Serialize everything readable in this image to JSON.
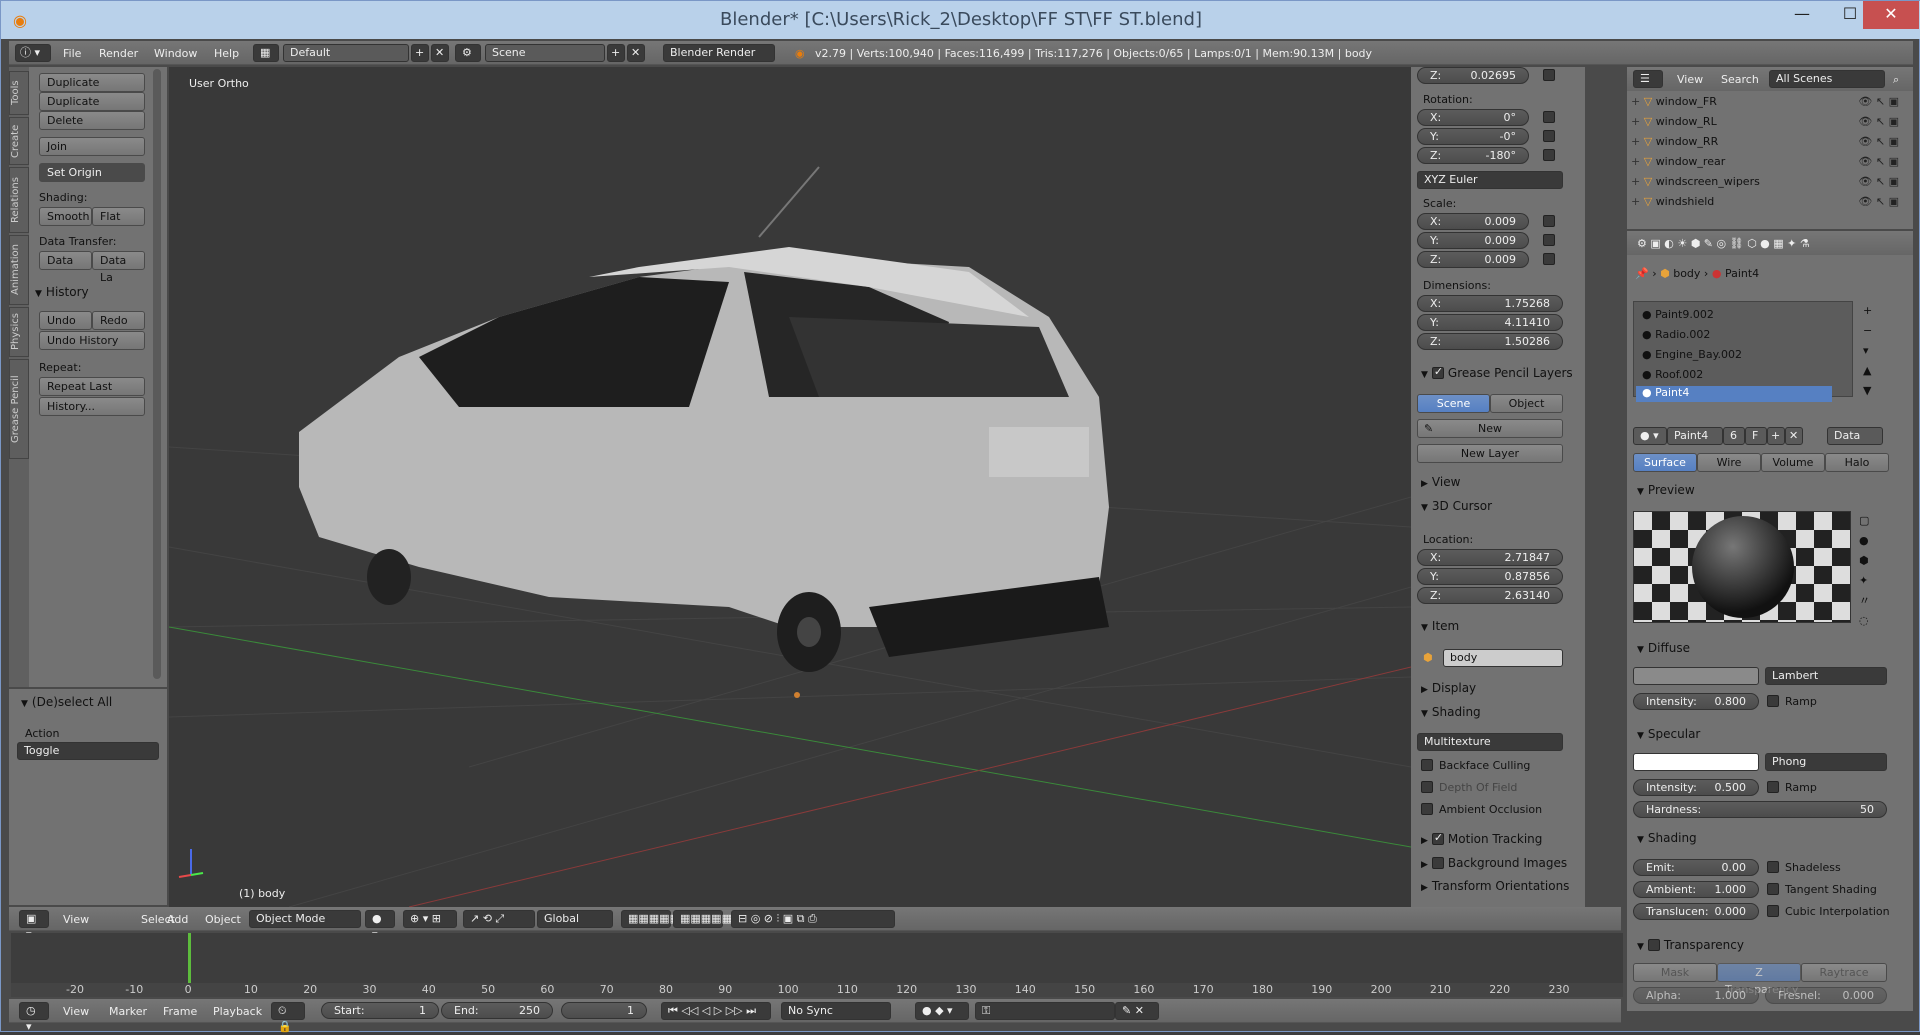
{
  "window": {
    "title": "Blender* [C:\\Users\\Rick_2\\Desktop\\FF ST\\FF ST.blend]",
    "min": "—",
    "max": "☐",
    "close": "✕"
  },
  "topbar": {
    "menus": [
      "File",
      "Render",
      "Window",
      "Help"
    ],
    "screen": "Default",
    "scene": "Scene",
    "engine": "Blender Render",
    "stats": "v2.79 | Verts:100,940 | Faces:116,499 | Tris:117,276 | Objects:0/65 | Lamps:0/1 | Mem:90.13M | body"
  },
  "tools": {
    "tabs": [
      "Tools",
      "Create",
      "Relations",
      "Animation",
      "Physics",
      "Grease Pencil"
    ],
    "duplicate": "Duplicate",
    "duplicate_linked": "Duplicate Linked",
    "delete": "Delete",
    "join": "Join",
    "set_origin": "Set Origin",
    "shading_label": "Shading:",
    "smooth": "Smooth",
    "flat": "Flat",
    "data_transfer_label": "Data Transfer:",
    "data": "Data",
    "data_la": "Data La",
    "history_header": "History",
    "undo": "Undo",
    "redo": "Redo",
    "undo_history": "Undo History",
    "repeat_label": "Repeat:",
    "repeat_last": "Repeat Last",
    "history_btn": "History...",
    "op_header": "(De)select All",
    "action_label": "Action",
    "action_value": "Toggle"
  },
  "viewport": {
    "view_label": "User Ortho",
    "object_label": "(1) body"
  },
  "vpheader": {
    "menus": [
      "View",
      "Select",
      "Add",
      "Object"
    ],
    "mode": "Object Mode",
    "orientation": "Global"
  },
  "npanel": {
    "loc_z_k": "Z:",
    "loc_z_v": "0.02695",
    "rotation_label": "Rotation:",
    "rot": [
      {
        "k": "X:",
        "v": "0°"
      },
      {
        "k": "Y:",
        "v": "-0°"
      },
      {
        "k": "Z:",
        "v": "-180°"
      }
    ],
    "rot_mode": "XYZ Euler",
    "scale_label": "Scale:",
    "scale": [
      {
        "k": "X:",
        "v": "0.009"
      },
      {
        "k": "Y:",
        "v": "0.009"
      },
      {
        "k": "Z:",
        "v": "0.009"
      }
    ],
    "dimensions_label": "Dimensions:",
    "dims": [
      {
        "k": "X:",
        "v": "1.75268"
      },
      {
        "k": "Y:",
        "v": "4.11410"
      },
      {
        "k": "Z:",
        "v": "1.50286"
      }
    ],
    "gp_header": "Grease Pencil Layers",
    "gp_scene": "Scene",
    "gp_object": "Object",
    "gp_new": "New",
    "gp_new_layer": "New Layer",
    "view_header": "View",
    "cursor_header": "3D Cursor",
    "location_label": "Location:",
    "cursor": [
      {
        "k": "X:",
        "v": "2.71847"
      },
      {
        "k": "Y:",
        "v": "0.87856"
      },
      {
        "k": "Z:",
        "v": "2.63140"
      }
    ],
    "item_header": "Item",
    "item_name": "body",
    "display_header": "Display",
    "shading_header": "Shading",
    "shading_mode": "Multitexture",
    "backface": "Backface Culling",
    "dof": "Depth Of Field",
    "ao": "Ambient Occlusion",
    "motion_tracking": "Motion Tracking",
    "bg_images": "Background Images",
    "transform_orient": "Transform Orientations"
  },
  "outliner": {
    "view": "View",
    "search": "Search",
    "filter": "All Scenes",
    "items": [
      "window_FR",
      "window_RL",
      "window_RR",
      "window_rear",
      "windscreen_wipers",
      "windshield"
    ]
  },
  "props": {
    "breadcrumb_obj": "body",
    "breadcrumb_mat": "Paint4",
    "materials": [
      "Paint9.002",
      "Radio.002",
      "Engine_Bay.002",
      "Roof.002",
      "Paint4"
    ],
    "mat_name": "Paint4",
    "mat_users": "6",
    "mat_f": "F",
    "mat_data": "Data",
    "tabs": [
      "Surface",
      "Wire",
      "Volume",
      "Halo"
    ],
    "preview_header": "Preview",
    "diffuse_header": "Diffuse",
    "diffuse_shader": "Lambert",
    "diffuse_int_k": "Intensity:",
    "diffuse_int_v": "0.800",
    "ramp": "Ramp",
    "specular_header": "Specular",
    "spec_shader": "Phong",
    "spec_int_k": "Intensity:",
    "spec_int_v": "0.500",
    "hard_k": "Hardness:",
    "hard_v": "50",
    "shading_header": "Shading",
    "emit_k": "Emit:",
    "emit_v": "0.00",
    "amb_k": "Ambient:",
    "amb_v": "1.000",
    "trans_k": "Translucen:",
    "trans_v": "0.000",
    "shadeless": "Shadeless",
    "tangent": "Tangent Shading",
    "cubic": "Cubic Interpolation",
    "transparency_header": "Transparency",
    "tr_tabs": [
      "Mask",
      "Z Transparency",
      "Raytrace"
    ],
    "alpha_k": "Alpha:",
    "alpha_v": "1.000",
    "fresnel_k": "Fresnel:",
    "fresnel_v": "0.000"
  },
  "timeline": {
    "ticks": [
      "-20",
      "-10",
      "0",
      "10",
      "20",
      "30",
      "40",
      "50",
      "60",
      "70",
      "80",
      "90",
      "100",
      "110",
      "120",
      "130",
      "140",
      "150",
      "160",
      "170",
      "180",
      "190",
      "200",
      "210",
      "220",
      "230"
    ],
    "menus": [
      "View",
      "Marker",
      "Frame",
      "Playback"
    ],
    "start_k": "Start:",
    "start_v": "1",
    "end_k": "End:",
    "end_v": "250",
    "current": "1",
    "sync": "No Sync"
  },
  "colors": {
    "accent": "#5680c2",
    "bg": "#393939",
    "title": "#b9d1ea"
  }
}
